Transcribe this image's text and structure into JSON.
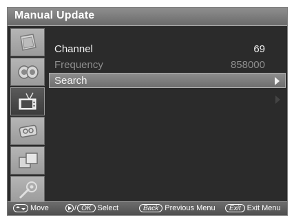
{
  "header": {
    "title": "Manual Update"
  },
  "sidebar": {
    "items": [
      {
        "icon": "picture-icon",
        "active": false
      },
      {
        "icon": "sound-icon",
        "active": false
      },
      {
        "icon": "channel-tv-icon",
        "active": true
      },
      {
        "icon": "feature-icon",
        "active": false
      },
      {
        "icon": "multi-window-icon",
        "active": false
      },
      {
        "icon": "setup-icon",
        "active": false
      }
    ]
  },
  "menu": {
    "rows": [
      {
        "label": "Channel",
        "value": "69",
        "state": "normal"
      },
      {
        "label": "Frequency",
        "value": "858000",
        "state": "disabled"
      },
      {
        "label": "Search",
        "value": "",
        "state": "selected"
      }
    ]
  },
  "help_bar": {
    "move": "Move",
    "select_separator": "/",
    "ok_key": "OK",
    "select": "Select",
    "back_key": "Back",
    "previous_menu": "Previous Menu",
    "exit_key": "Exit",
    "exit_menu": "Exit Menu"
  },
  "colors": {
    "background": "#2b2b2b",
    "selected": "#7d7d7d",
    "disabled_text": "#8e8e8e"
  }
}
